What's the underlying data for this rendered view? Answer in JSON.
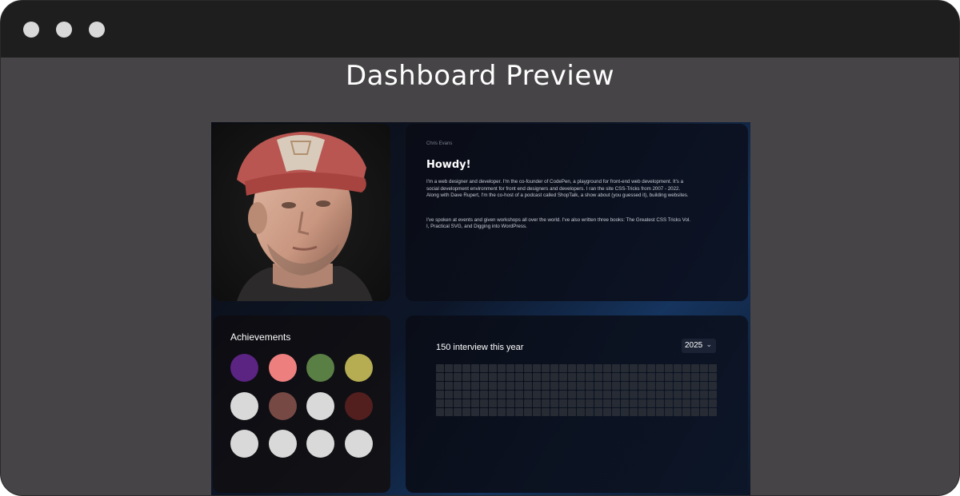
{
  "page_title": "Dashboard Preview",
  "intro": {
    "name": "Chris Evans",
    "heading": "Howdy!",
    "paragraph1": "I'm a web designer and developer. I'm the co-founder of CodePen, a playground for front-end web development. It's a social development environment for front end designers and developers. I ran the site CSS-Tricks from 2007 - 2022. Along with Dave Rupert, I'm the co-host of a podcast called ShopTalk, a show about (you guessed it), building websites.",
    "paragraph2": "I've spoken at events and given workshops all over the world. I've also written three books: The Greatest CSS Tricks Vol. I, Practical SVG, and Digging into WordPress."
  },
  "achievements": {
    "title": "Achievements",
    "badge_colors": [
      "#5b2382",
      "#ee7f7f",
      "#5a7f45",
      "#b6ad53",
      "#d9d9d9",
      "#764944",
      "#d9d9d9",
      "#531e1e",
      "#d9d9d9",
      "#d9d9d9",
      "#d9d9d9",
      "#d9d9d9"
    ]
  },
  "interviews": {
    "title": "150 interview this year",
    "year": "2025",
    "grid_rows": 6,
    "grid_cols": 32,
    "cell_color": "#272b34"
  },
  "icons": {
    "year_chevron": "chevron-down-icon"
  }
}
